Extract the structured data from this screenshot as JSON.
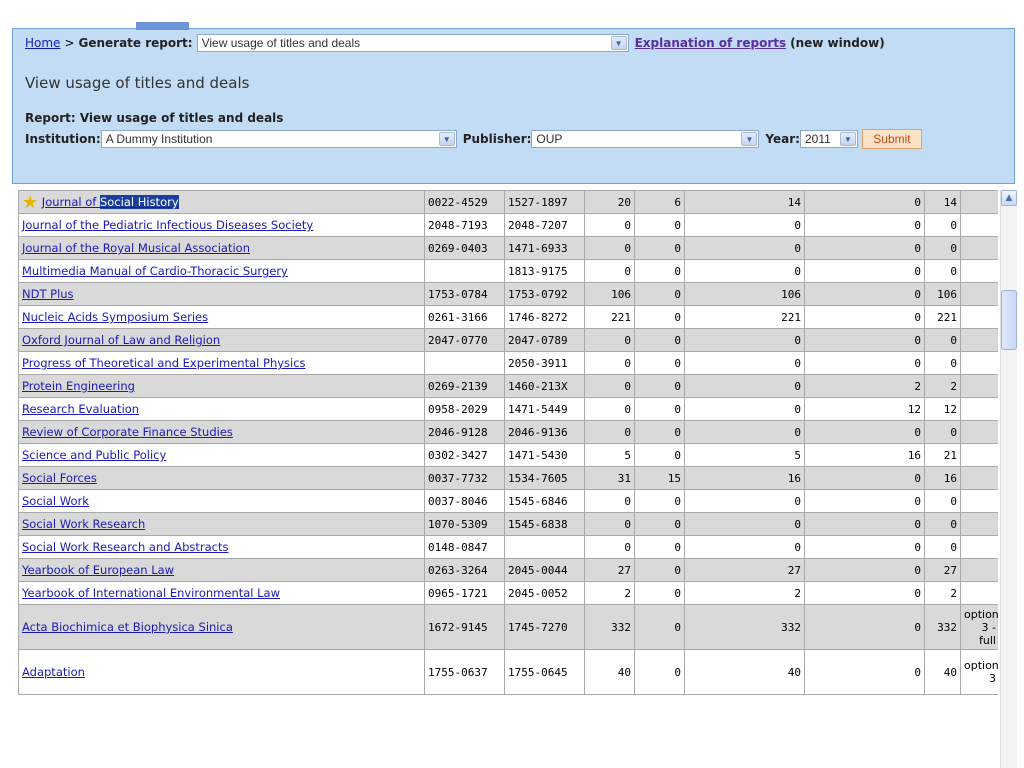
{
  "breadcrumb": {
    "home": "Home",
    "separator": ">",
    "current": "Generate report:"
  },
  "report_select": {
    "value": "View usage of titles and deals"
  },
  "explanation": {
    "link": "Explanation of reports",
    "suffix": "(new window)"
  },
  "page_title": "View usage of titles and deals",
  "report_label": "Report: View usage of titles and deals",
  "filters": {
    "institution_label": "Institution:",
    "institution_value": "A Dummy Institution",
    "publisher_label": "Publisher:",
    "publisher_value": "OUP",
    "year_label": "Year:",
    "year_value": "2011",
    "submit": "Submit"
  },
  "rows": [
    {
      "title_prefix": "Journal of ",
      "title_highlight": "Social History",
      "issn": "0022-4529",
      "eissn": "1527-1897",
      "c1": "20",
      "c2": "6",
      "c3": "14",
      "c4": "0",
      "c5": "14",
      "note": "",
      "starred": true
    },
    {
      "title": "Journal of the Pediatric Infectious Diseases Society",
      "issn": "2048-7193",
      "eissn": "2048-7207",
      "c1": "0",
      "c2": "0",
      "c3": "0",
      "c4": "0",
      "c5": "0",
      "note": ""
    },
    {
      "title": "Journal of the Royal Musical Association",
      "issn": "0269-0403",
      "eissn": "1471-6933",
      "c1": "0",
      "c2": "0",
      "c3": "0",
      "c4": "0",
      "c5": "0",
      "note": ""
    },
    {
      "title": "Multimedia Manual of Cardio-Thoracic Surgery",
      "issn": "",
      "eissn": "1813-9175",
      "c1": "0",
      "c2": "0",
      "c3": "0",
      "c4": "0",
      "c5": "0",
      "note": ""
    },
    {
      "title": "NDT Plus",
      "issn": "1753-0784",
      "eissn": "1753-0792",
      "c1": "106",
      "c2": "0",
      "c3": "106",
      "c4": "0",
      "c5": "106",
      "note": ""
    },
    {
      "title": "Nucleic Acids Symposium Series",
      "issn": "0261-3166",
      "eissn": "1746-8272",
      "c1": "221",
      "c2": "0",
      "c3": "221",
      "c4": "0",
      "c5": "221",
      "note": ""
    },
    {
      "title": "Oxford Journal of Law and Religion",
      "issn": "2047-0770",
      "eissn": "2047-0789",
      "c1": "0",
      "c2": "0",
      "c3": "0",
      "c4": "0",
      "c5": "0",
      "note": ""
    },
    {
      "title": "Progress of Theoretical and Experimental Physics",
      "issn": "",
      "eissn": "2050-3911",
      "c1": "0",
      "c2": "0",
      "c3": "0",
      "c4": "0",
      "c5": "0",
      "note": ""
    },
    {
      "title": "Protein Engineering",
      "issn": "0269-2139",
      "eissn": "1460-213X",
      "c1": "0",
      "c2": "0",
      "c3": "0",
      "c4": "2",
      "c5": "2",
      "note": ""
    },
    {
      "title": "Research Evaluation",
      "issn": "0958-2029",
      "eissn": "1471-5449",
      "c1": "0",
      "c2": "0",
      "c3": "0",
      "c4": "12",
      "c5": "12",
      "note": ""
    },
    {
      "title": "Review of Corporate Finance Studies",
      "issn": "2046-9128",
      "eissn": "2046-9136",
      "c1": "0",
      "c2": "0",
      "c3": "0",
      "c4": "0",
      "c5": "0",
      "note": ""
    },
    {
      "title": "Science and Public Policy",
      "issn": "0302-3427",
      "eissn": "1471-5430",
      "c1": "5",
      "c2": "0",
      "c3": "5",
      "c4": "16",
      "c5": "21",
      "note": ""
    },
    {
      "title": "Social Forces",
      "issn": "0037-7732",
      "eissn": "1534-7605",
      "c1": "31",
      "c2": "15",
      "c3": "16",
      "c4": "0",
      "c5": "16",
      "note": ""
    },
    {
      "title": "Social Work",
      "issn": "0037-8046",
      "eissn": "1545-6846",
      "c1": "0",
      "c2": "0",
      "c3": "0",
      "c4": "0",
      "c5": "0",
      "note": ""
    },
    {
      "title": "Social Work Research",
      "issn": "1070-5309",
      "eissn": "1545-6838",
      "c1": "0",
      "c2": "0",
      "c3": "0",
      "c4": "0",
      "c5": "0",
      "note": ""
    },
    {
      "title": "Social Work Research and Abstracts",
      "issn": "0148-0847",
      "eissn": "",
      "c1": "0",
      "c2": "0",
      "c3": "0",
      "c4": "0",
      "c5": "0",
      "note": ""
    },
    {
      "title": "Yearbook of European Law",
      "issn": "0263-3264",
      "eissn": "2045-0044",
      "c1": "27",
      "c2": "0",
      "c3": "27",
      "c4": "0",
      "c5": "27",
      "note": ""
    },
    {
      "title": "Yearbook of International Environmental Law",
      "issn": "0965-1721",
      "eissn": "2045-0052",
      "c1": "2",
      "c2": "0",
      "c3": "2",
      "c4": "0",
      "c5": "2",
      "note": ""
    },
    {
      "title": "Acta Biochimica et Biophysica Sinica",
      "issn": "1672-9145",
      "eissn": "1745-7270",
      "c1": "332",
      "c2": "0",
      "c3": "332",
      "c4": "0",
      "c5": "332",
      "note": "option 3 - full",
      "tall": true
    },
    {
      "title": "Adaptation",
      "issn": "1755-0637",
      "eissn": "1755-0645",
      "c1": "40",
      "c2": "0",
      "c3": "40",
      "c4": "0",
      "c5": "40",
      "note": "option 3",
      "tall": true
    }
  ],
  "icons": {
    "star": "star-icon",
    "dropdown": "chevron-down-icon",
    "scroll_up": "scroll-up-arrow-icon"
  }
}
